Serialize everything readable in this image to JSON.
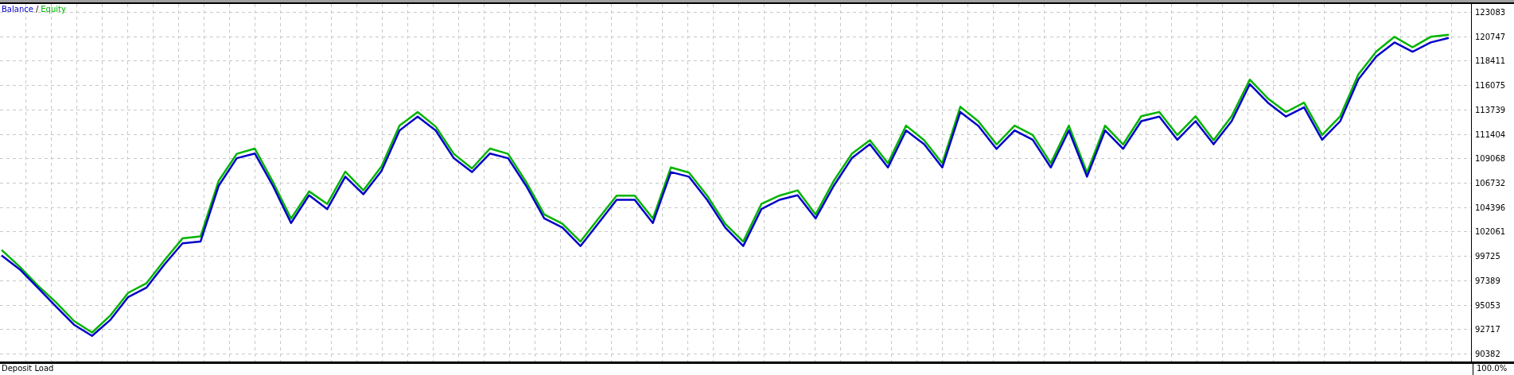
{
  "chart": {
    "legend": {
      "separator": "/"
    },
    "chart_data": {
      "type": "line",
      "grid": true,
      "ylim": [
        90382,
        123083
      ],
      "yticks": [
        123083,
        120747,
        118411,
        116075,
        113739,
        111404,
        109068,
        106732,
        104396,
        102061,
        99725,
        97389,
        95053,
        92717,
        90382
      ],
      "series": [
        {
          "name": "Balance",
          "color": "#0000c8",
          "values": [
            99780,
            98450,
            96680,
            94900,
            93140,
            92070,
            93580,
            95800,
            96680,
            98900,
            100930,
            101110,
            106430,
            109080,
            109530,
            106430,
            102880,
            105540,
            104210,
            107310,
            105630,
            107860,
            111740,
            113070,
            111740,
            109080,
            107750,
            109530,
            109080,
            106430,
            103320,
            102440,
            100670,
            102880,
            105100,
            105100,
            102880,
            107750,
            107310,
            105100,
            102440,
            100670,
            104210,
            105100,
            105540,
            103320,
            106430,
            109080,
            110410,
            108190,
            111740,
            110410,
            108190,
            113510,
            112180,
            109970,
            111740,
            110850,
            108190,
            111740,
            107310,
            111740,
            109970,
            112630,
            113070,
            110850,
            112630,
            110410,
            112630,
            116170,
            114400,
            113070,
            113950,
            110850,
            112630,
            116610,
            118830,
            120160,
            119270,
            120160,
            120600
          ]
        },
        {
          "name": "Equity",
          "color": "#00b400",
          "values": [
            100300,
            98700,
            96900,
            95300,
            93500,
            92400,
            94000,
            96200,
            97100,
            99300,
            101400,
            101600,
            106900,
            109500,
            110000,
            106800,
            103300,
            105900,
            104700,
            107800,
            106000,
            108300,
            112200,
            113500,
            112100,
            109500,
            108100,
            110000,
            109500,
            106800,
            103700,
            102800,
            101100,
            103300,
            105500,
            105500,
            103300,
            108200,
            107700,
            105500,
            102800,
            101100,
            104700,
            105500,
            106000,
            103700,
            106900,
            109500,
            110800,
            108600,
            112200,
            110800,
            108600,
            114000,
            112600,
            110400,
            112200,
            111300,
            108600,
            112200,
            107700,
            112200,
            110400,
            113100,
            113500,
            111300,
            113100,
            110800,
            113100,
            116600,
            114800,
            113500,
            114400,
            111300,
            113100,
            117100,
            119300,
            120700,
            119700,
            120700,
            120900
          ]
        }
      ]
    }
  },
  "bottom_panel": {
    "title": "Deposit Load",
    "reading": "100.0%"
  }
}
